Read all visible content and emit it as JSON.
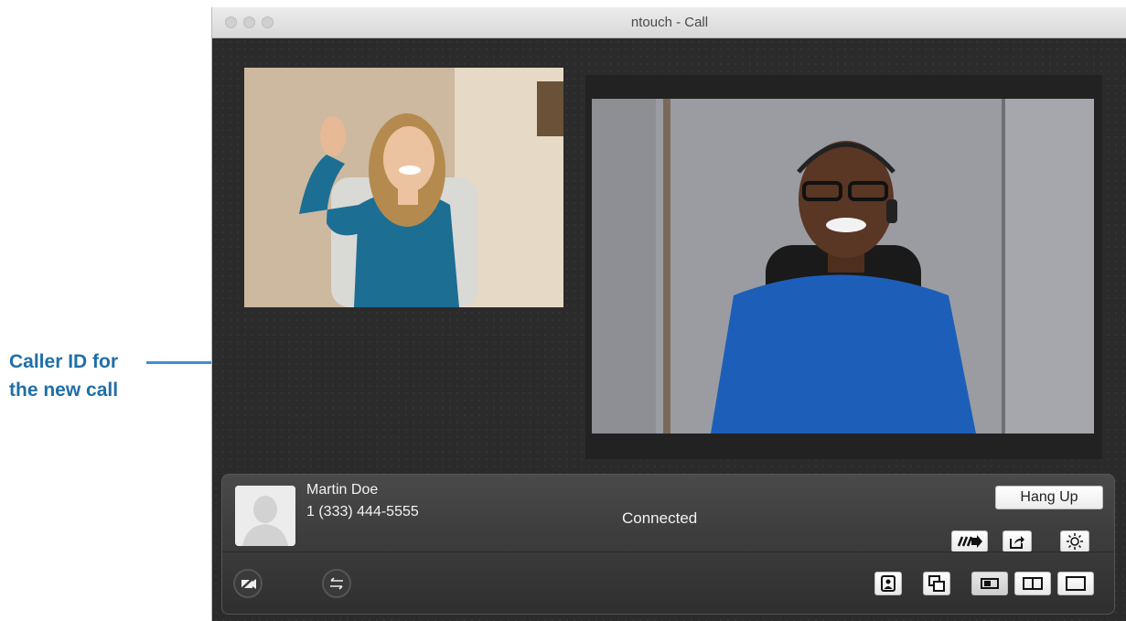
{
  "annotation": {
    "line1": "Caller ID for",
    "line2": "the new call"
  },
  "window": {
    "title": "ntouch - Call"
  },
  "call": {
    "caller_name": "Martin Doe",
    "caller_number": "1 (333) 444-5555",
    "status": "Connected",
    "hang_up_label": "Hang Up"
  },
  "icons": {
    "camera_off": "camera-off-icon",
    "swap_video": "swap-arrows-icon",
    "transfer": "transfer-arrow-icon",
    "share": "share-icon",
    "brightness": "brightness-icon",
    "self_view_toggle": "self-view-icon",
    "pip": "picture-in-picture-icon",
    "layout_small": "layout-small-icon",
    "layout_split": "layout-split-icon",
    "layout_full": "layout-full-icon"
  },
  "colors": {
    "callout": "#1f6fa8",
    "callout_line": "#3d8fd9"
  }
}
